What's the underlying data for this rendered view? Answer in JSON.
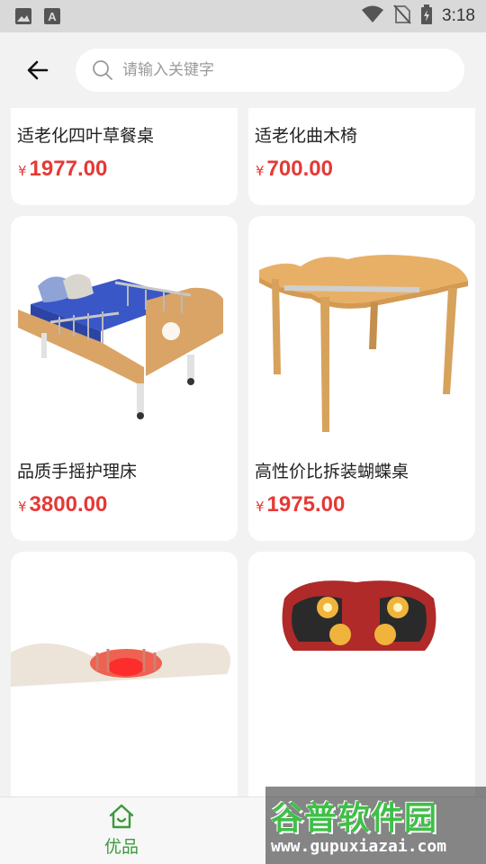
{
  "status_bar": {
    "time": "3:18",
    "icons": [
      "image-icon",
      "a-font-icon",
      "wifi-icon",
      "no-sim-icon",
      "battery-icon"
    ]
  },
  "header": {
    "back_icon": "arrow-left-icon",
    "search": {
      "placeholder": "请输入关键字",
      "value": "",
      "icon": "search-icon"
    }
  },
  "products": [
    {
      "name": "适老化四叶草餐桌",
      "currency": "¥",
      "price": "1977.00",
      "image": "clover-dining-table-image"
    },
    {
      "name": "适老化曲木椅",
      "currency": "¥",
      "price": "700.00",
      "image": "bentwood-chair-image"
    },
    {
      "name": "品质手摇护理床",
      "currency": "¥",
      "price": "3800.00",
      "image": "hand-crank-nursing-bed-image"
    },
    {
      "name": "高性价比拆装蝴蝶桌",
      "currency": "¥",
      "price": "1975.00",
      "image": "butterfly-table-image"
    },
    {
      "name": "",
      "currency": "",
      "price": "",
      "image": "massage-neck-pillow-image"
    },
    {
      "name": "",
      "currency": "",
      "price": "",
      "image": "massage-shoulder-cushion-image"
    }
  ],
  "bottom_nav": {
    "items": [
      {
        "label": "优品",
        "icon": "home-icon",
        "active": true
      }
    ]
  },
  "watermark": {
    "title": "谷普软件园",
    "url": "www.gupuxiazai.com"
  },
  "colors": {
    "price": "#e53935",
    "accent_green": "#3c9a3c",
    "background": "#f2f2f2",
    "card": "#ffffff"
  }
}
